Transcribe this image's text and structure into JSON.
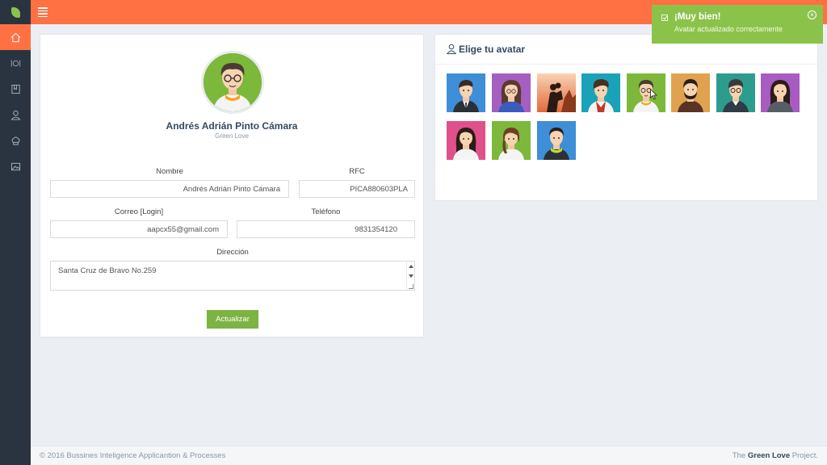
{
  "colors": {
    "accent": "#ff7043",
    "sidebar": "#2a3440",
    "green": "#8bc34a",
    "button": "#7cb342"
  },
  "sidebar": {
    "items": [
      {
        "icon": "home-icon",
        "active": true
      },
      {
        "icon": "restaurant-icon",
        "active": false
      },
      {
        "icon": "book-icon",
        "active": false
      },
      {
        "icon": "user-icon",
        "active": false
      },
      {
        "icon": "chef-hat-icon",
        "active": false
      },
      {
        "icon": "gallery-icon",
        "active": false
      }
    ]
  },
  "profile": {
    "name": "Andrés Adrián Pinto Cámara",
    "organization": "Green Love",
    "fields": {
      "nombre": {
        "label": "Nombre",
        "value": "Andrés Adrián Pinto Cámara"
      },
      "rfc": {
        "label": "RFC",
        "value": "PICA880603PLA"
      },
      "correo": {
        "label": "Correo [Login]",
        "value": "aapcx55@gmail.com"
      },
      "telefono": {
        "label": "Teléfono",
        "value": "9831354120"
      },
      "direccion": {
        "label": "Dirección",
        "value": "Santa Cruz de Bravo No.259"
      }
    },
    "update_button": "Actualizar"
  },
  "avatars": {
    "title": "Elige tu avatar",
    "items": [
      {
        "bg": "#3e8ed8",
        "icon": "man-suit-avatar"
      },
      {
        "bg": "#a55fc0",
        "icon": "woman-glasses-avatar"
      },
      {
        "bg": "#f4b78f",
        "icon": "couple-silhouette-avatar"
      },
      {
        "bg": "#1aa3b8",
        "icon": "young-man-avatar"
      },
      {
        "bg": "#7cb83a",
        "icon": "man-glasses-avatar"
      },
      {
        "bg": "#e0a24e",
        "icon": "bearded-man-avatar"
      },
      {
        "bg": "#2c9c8f",
        "icon": "man-glasses-beard-avatar"
      },
      {
        "bg": "#a85cc1",
        "icon": "woman-dark-hair-avatar"
      },
      {
        "bg": "#e0508a",
        "icon": "woman-pink-avatar"
      },
      {
        "bg": "#7cb83a",
        "icon": "woman-braid-avatar"
      },
      {
        "bg": "#3e8ed8",
        "icon": "boy-scarf-avatar"
      }
    ]
  },
  "toast": {
    "title": "¡Muy bien!",
    "message": "Avatar actualizado correctamente"
  },
  "footer": {
    "left": "© 2016 Bussines Inteligence Applicantion & Processes",
    "right_prefix": "The",
    "right_brand": "Green Love",
    "right_suffix": "Project."
  }
}
